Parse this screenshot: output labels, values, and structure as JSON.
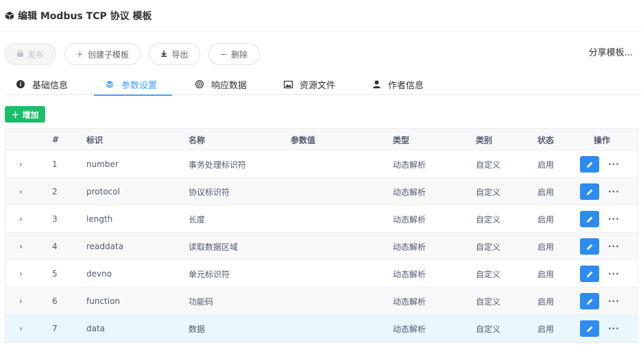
{
  "header": {
    "title": "编辑 Modbus TCP 协议 模板",
    "icon": "cube-icon"
  },
  "toolbar": {
    "publish_label": "发布",
    "create_child_label": "创建子模板",
    "export_label": "导出",
    "delete_label": "删除",
    "share_label": "分享模板..."
  },
  "tabs": [
    {
      "label": "基础信息",
      "icon": "info-icon"
    },
    {
      "label": "参数设置",
      "icon": "layers-icon",
      "active": true
    },
    {
      "label": "响应数据",
      "icon": "target-icon"
    },
    {
      "label": "资源文件",
      "icon": "image-icon"
    },
    {
      "label": "作者信息",
      "icon": "user-icon"
    }
  ],
  "add_label": "增加",
  "table": {
    "columns": [
      "#",
      "标识",
      "名称",
      "参数值",
      "类型",
      "类别",
      "状态",
      "操作"
    ],
    "rows": [
      {
        "index": "1",
        "key": "number",
        "name": "事务处理标识符",
        "value": "",
        "type": "动态解析",
        "category": "自定义",
        "status": "启用"
      },
      {
        "index": "2",
        "key": "protocol",
        "name": "协议标识符",
        "value": "",
        "type": "动态解析",
        "category": "自定义",
        "status": "启用"
      },
      {
        "index": "3",
        "key": "length",
        "name": "长度",
        "value": "",
        "type": "动态解析",
        "category": "自定义",
        "status": "启用"
      },
      {
        "index": "4",
        "key": "readdata",
        "name": "读取数据区域",
        "value": "",
        "type": "动态解析",
        "category": "自定义",
        "status": "启用"
      },
      {
        "index": "5",
        "key": "devno",
        "name": "单元标识符",
        "value": "",
        "type": "动态解析",
        "category": "自定义",
        "status": "启用"
      },
      {
        "index": "6",
        "key": "function",
        "name": "功能码",
        "value": "",
        "type": "动态解析",
        "category": "自定义",
        "status": "启用"
      },
      {
        "index": "7",
        "key": "data",
        "name": "数据",
        "value": "",
        "type": "动态解析",
        "category": "自定义",
        "status": "启用"
      }
    ],
    "more_label": "···",
    "expand_glyph": "›"
  },
  "colors": {
    "primary": "#409eff",
    "edit_button": "#2d8cf0",
    "add_button": "#19be6b",
    "highlight_row": "#ebf7ff"
  }
}
